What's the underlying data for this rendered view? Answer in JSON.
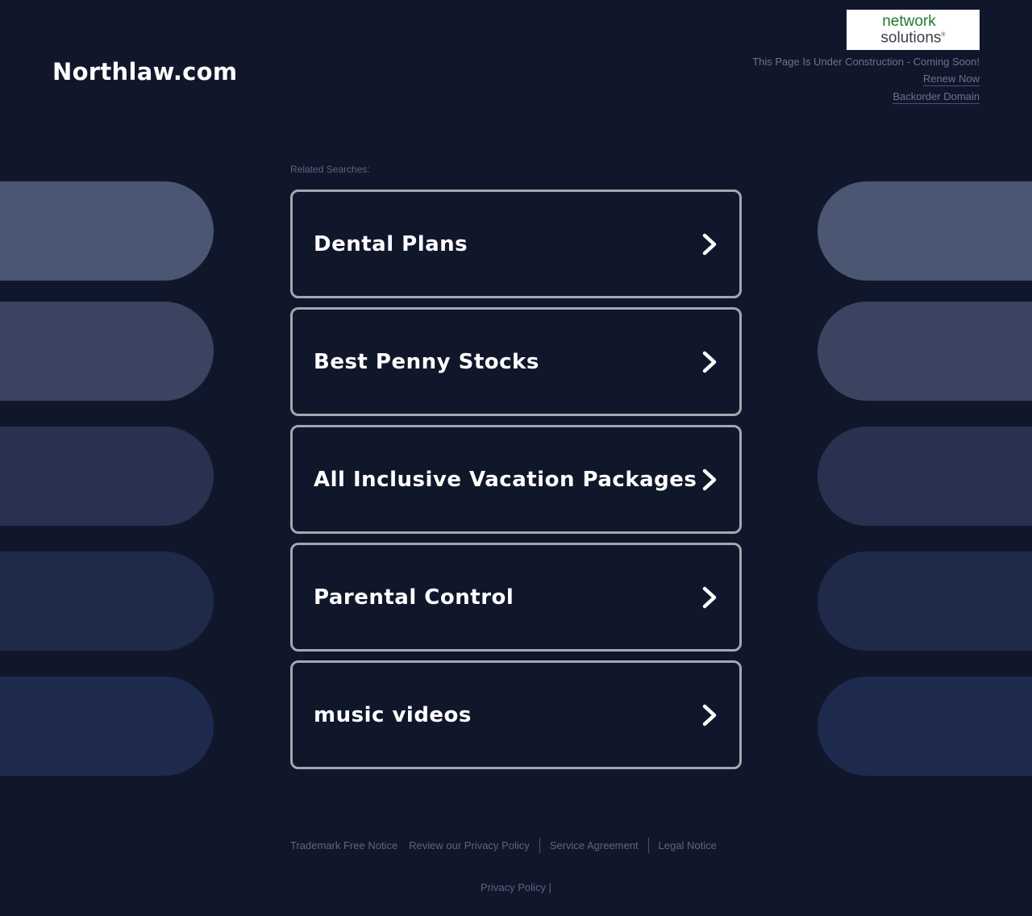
{
  "header": {
    "domain_title": "Northlaw.com",
    "logo": {
      "line1": "network",
      "line2": "solutions",
      "registered": "®"
    },
    "notice": "This Page Is Under Construction - Coming Soon!",
    "renew_link": "Renew Now",
    "backorder_link": "Backorder Domain"
  },
  "related": {
    "label": "Related Searches:",
    "items": [
      {
        "label": "Dental Plans",
        "icon": "chevron-right-icon"
      },
      {
        "label": "Best Penny Stocks",
        "icon": "chevron-right-icon"
      },
      {
        "label": "All Inclusive Vacation Packages",
        "icon": "chevron-right-icon"
      },
      {
        "label": "Parental Control",
        "icon": "chevron-right-icon"
      },
      {
        "label": "music videos",
        "icon": "chevron-right-icon"
      }
    ]
  },
  "decor": {
    "pill_colors": [
      "#4b5673",
      "#3a4460",
      "#283250",
      "#1f2a4a",
      "#1e2a4d"
    ]
  },
  "footer": {
    "links": [
      "Trademark Free Notice",
      "Review our Privacy Policy",
      "Service Agreement",
      "Legal Notice"
    ],
    "privacy": "Privacy Policy",
    "privacy_sep": "|"
  }
}
